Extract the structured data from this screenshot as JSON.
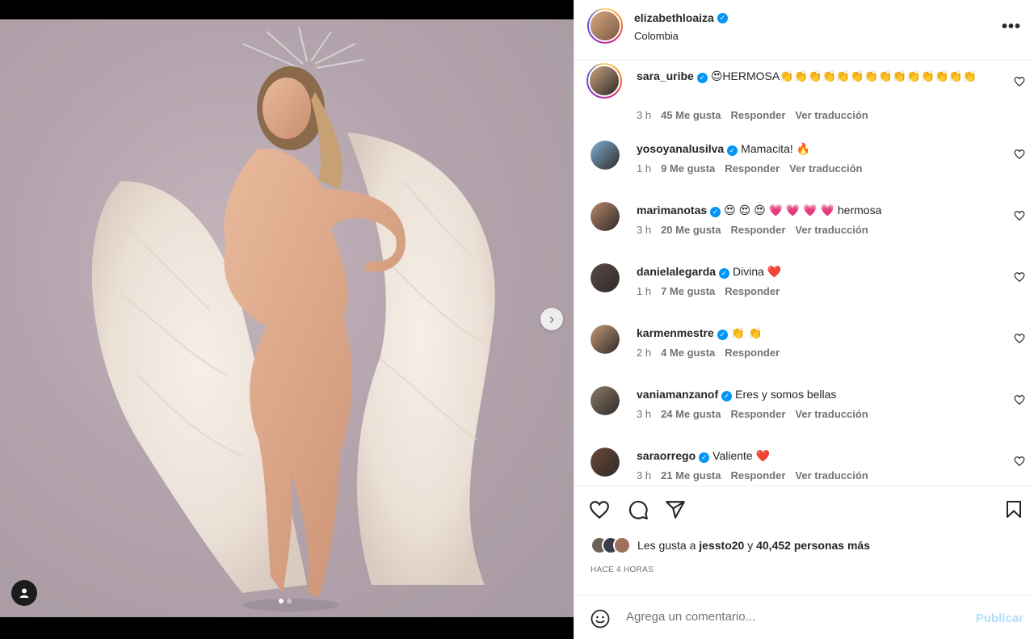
{
  "post": {
    "username": "elizabethloaiza",
    "location": "Colombia",
    "more_label": "•••",
    "carousel": {
      "total": 2,
      "active": 1
    }
  },
  "comments": [
    {
      "username": "sara_uribe",
      "text": "😍HERMOSA👏👏👏👏👏👏👏👏👏👏👏👏👏👏",
      "time": "3 h",
      "likes": "45 Me gusta",
      "reply": "Responder",
      "translate": "Ver traducción",
      "ring": true,
      "color": "#c9a27c"
    },
    {
      "username": "yosoyanalusilva",
      "text": "Mamacita! 🔥",
      "time": "1 h",
      "likes": "9 Me gusta",
      "reply": "Responder",
      "translate": "Ver traducción",
      "ring": false,
      "color": "#7fb0d6"
    },
    {
      "username": "marimanotas",
      "text": "😍 😍 😍 💗 💗 💗 💗 hermosa",
      "time": "3 h",
      "likes": "20 Me gusta",
      "reply": "Responder",
      "translate": "Ver traducción",
      "ring": false,
      "color": "#b8876a"
    },
    {
      "username": "danielalegarda",
      "text": "Divina ❤️",
      "time": "1 h",
      "likes": "7 Me gusta",
      "reply": "Responder",
      "translate": "",
      "ring": false,
      "color": "#5a4a48"
    },
    {
      "username": "karmenmestre",
      "text": "👏 👏",
      "time": "2 h",
      "likes": "4 Me gusta",
      "reply": "Responder",
      "translate": "",
      "ring": false,
      "color": "#c49a78"
    },
    {
      "username": "vaniamanzanof",
      "text": "Eres y somos bellas",
      "time": "3 h",
      "likes": "24 Me gusta",
      "reply": "Responder",
      "translate": "Ver traducción",
      "ring": false,
      "color": "#8c7a6a"
    },
    {
      "username": "saraorrego",
      "text": "Valiente ❤️",
      "time": "3 h",
      "likes": "21 Me gusta",
      "reply": "Responder",
      "translate": "Ver traducción",
      "ring": false,
      "color": "#6b4a3a"
    }
  ],
  "likes": {
    "prefix": "Les gusta a",
    "user": "jessto20",
    "and": "y",
    "count": "40,452 personas más"
  },
  "time_ago": "HACE 4 HORAS",
  "comment_box": {
    "placeholder": "Agrega un comentario...",
    "publish": "Publicar"
  },
  "colors": {
    "verified": "#0095f6",
    "publish_disabled": "#b2dffc",
    "meta_gray": "#737373"
  },
  "icons": [
    "chevron-right-icon",
    "user-tag-icon",
    "verified-icon",
    "more-icon",
    "heart-icon",
    "comment-icon",
    "share-icon",
    "bookmark-icon",
    "emoji-icon"
  ]
}
